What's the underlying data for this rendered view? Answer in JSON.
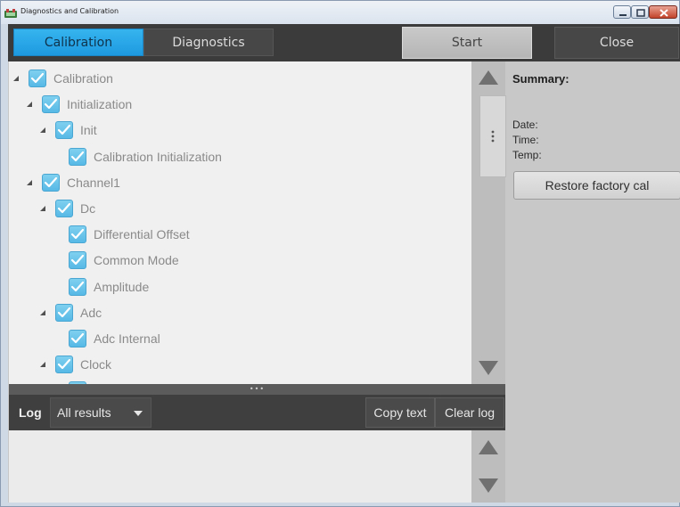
{
  "window": {
    "title": "Diagnostics and Calibration"
  },
  "toolbar": {
    "tab_calibration": "Calibration",
    "tab_diagnostics": "Diagnostics",
    "start_label": "Start",
    "close_label": "Close",
    "active_tab": "Calibration"
  },
  "tree": {
    "items": [
      {
        "label": "Calibration",
        "level": 0,
        "expandable": true,
        "checked": true
      },
      {
        "label": "Initialization",
        "level": 1,
        "expandable": true,
        "checked": true
      },
      {
        "label": "Init",
        "level": 2,
        "expandable": true,
        "checked": true
      },
      {
        "label": "Calibration Initialization",
        "level": 3,
        "expandable": false,
        "checked": true
      },
      {
        "label": "Channel1",
        "level": 1,
        "expandable": true,
        "checked": true
      },
      {
        "label": "Dc",
        "level": 2,
        "expandable": true,
        "checked": true
      },
      {
        "label": "Differential Offset",
        "level": 3,
        "expandable": false,
        "checked": true
      },
      {
        "label": "Common Mode",
        "level": 3,
        "expandable": false,
        "checked": true
      },
      {
        "label": "Amplitude",
        "level": 3,
        "expandable": false,
        "checked": true
      },
      {
        "label": "Adc",
        "level": 2,
        "expandable": true,
        "checked": true
      },
      {
        "label": "Adc Internal",
        "level": 3,
        "expandable": false,
        "checked": true
      },
      {
        "label": "Clock",
        "level": 2,
        "expandable": true,
        "checked": true
      },
      {
        "label": "",
        "level": 3,
        "expandable": false,
        "checked": true
      }
    ]
  },
  "summary": {
    "title": "Summary:",
    "date_label": "Date:",
    "time_label": "Time:",
    "temp_label": "Temp:",
    "restore_label": "Restore factory cal"
  },
  "log": {
    "label": "Log",
    "filter_value": "All results",
    "copy_label": "Copy text",
    "clear_label": "Clear log"
  },
  "colors": {
    "accent": "#29a8e8",
    "toolbar_bg": "#3b3b3b",
    "check_fill": "#6cc6ec"
  },
  "icons": {
    "app": "app-icon",
    "expander": "triangle-expanded-icon",
    "check": "checkmark-icon",
    "scroll_up": "triangle-up-icon",
    "scroll_down": "triangle-down-icon",
    "dropdown": "caret-down-icon"
  }
}
